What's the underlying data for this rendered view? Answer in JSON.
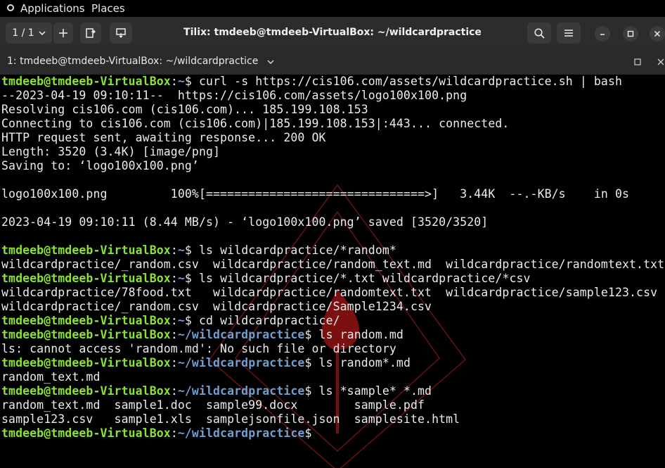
{
  "topbar": {
    "applications": "Applications",
    "places": "Places"
  },
  "window": {
    "title": "Tilix: tmdeeb@tmdeeb-VirtualBox: ~/wildcardpractice",
    "session_label": "1 / 1"
  },
  "tab": {
    "label": "1: tmdeeb@tmdeeb-VirtualBox: ~/wildcardpractice"
  },
  "terminal": {
    "user_host": "tmdeeb@tmdeeb-VirtualBox",
    "lines": [
      {
        "type": "prompt",
        "path": "~",
        "cmd": " curl -s https://cis106.com/assets/wildcardpractice.sh | bash"
      },
      {
        "type": "out",
        "text": "--2023-04-19 09:10:11--  https://cis106.com/assets/logo100x100.png"
      },
      {
        "type": "out",
        "text": "Resolving cis106.com (cis106.com)... 185.199.108.153"
      },
      {
        "type": "out",
        "text": "Connecting to cis106.com (cis106.com)|185.199.108.153|:443... connected."
      },
      {
        "type": "out",
        "text": "HTTP request sent, awaiting response... 200 OK"
      },
      {
        "type": "out",
        "text": "Length: 3520 (3.4K) [image/png]"
      },
      {
        "type": "out",
        "text": "Saving to: ‘logo100x100.png’"
      },
      {
        "type": "out",
        "text": ""
      },
      {
        "type": "out",
        "text": "logo100x100.png         100%[===============================>]   3.44K  --.-KB/s    in 0s"
      },
      {
        "type": "out",
        "text": ""
      },
      {
        "type": "out",
        "text": "2023-04-19 09:10:11 (8.44 MB/s) - ‘logo100x100.png’ saved [3520/3520]"
      },
      {
        "type": "out",
        "text": ""
      },
      {
        "type": "prompt",
        "path": "~",
        "cmd": " ls wildcardpractice/*random*"
      },
      {
        "type": "out",
        "text": "wildcardpractice/_random.csv  wildcardpractice/random_text.md  wildcardpractice/randomtext.txt"
      },
      {
        "type": "prompt",
        "path": "~",
        "cmd": " ls wildcardpractice/*.txt wildcardpractice/*csv"
      },
      {
        "type": "out",
        "text": "wildcardpractice/78food.txt   wildcardpractice/randomtext.txt  wildcardpractice/sample123.csv"
      },
      {
        "type": "out",
        "text": "wildcardpractice/_random.csv  wildcardpractice/Sample1234.csv"
      },
      {
        "type": "prompt",
        "path": "~",
        "cmd": " cd wildcardpractice/"
      },
      {
        "type": "prompt",
        "path": "~/wildcardpractice",
        "cmd": " ls random.md"
      },
      {
        "type": "out",
        "text": "ls: cannot access 'random.md': No such file or directory"
      },
      {
        "type": "prompt",
        "path": "~/wildcardpractice",
        "cmd": " ls random*.md"
      },
      {
        "type": "out",
        "text": "random_text.md"
      },
      {
        "type": "prompt",
        "path": "~/wildcardpractice",
        "cmd": " ls *sample* *.md"
      },
      {
        "type": "out",
        "text": "random_text.md  sample1.doc  sample99.docx        sample.pdf"
      },
      {
        "type": "out",
        "text": "sample123.csv   sample1.xls  samplejsonfile.json  samplesite.html"
      },
      {
        "type": "prompt",
        "path": "~/wildcardpractice",
        "cmd": ""
      }
    ]
  },
  "colors": {
    "user": "#8ae234",
    "path": "#729fcf",
    "watermark": "#6b1212"
  }
}
